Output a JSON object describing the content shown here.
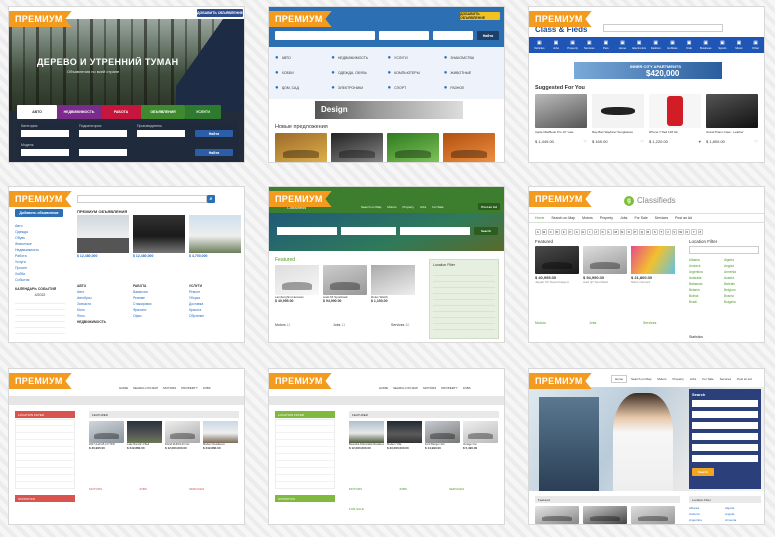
{
  "badge": "ПРЕМИУМ",
  "t1": {
    "hero_title": "ДЕРЕВО И УТРЕННИЙ ТУМАН",
    "hero_sub": "Объявления по всей стране",
    "tabs": [
      "АВТО",
      "НЕДВИЖИМОСТЬ",
      "РАБОТА",
      "ОБЪЯВЛЕНИЯ",
      "УСЛУГИ"
    ],
    "f_labels": [
      "Категория",
      "Подкатегория",
      "Производитель",
      "Модель"
    ],
    "find": "Найти",
    "top": "ДОБАВИТЬ ОБЪЯВЛЕНИЕ"
  },
  "t2": {
    "post": "ДОБАВИТЬ ОБЪЯВЛЕНИЕ",
    "search": "Найти",
    "cats": [
      "АВТО",
      "НЕДВИЖИМОСТЬ",
      "УСЛУГИ",
      "ЗНАКОМСТВА",
      "ХОББИ",
      "ОДЕЖДА, ОБУВЬ",
      "КОМПЬЮТЕРЫ",
      "ЖИВОТНЫЕ",
      "ДОМ, САД",
      "ЭЛЕКТРОНИКА",
      "СПОРТ",
      "РАЗНОЕ"
    ],
    "banner": "Design",
    "new": "Новые предложения"
  },
  "t3": {
    "logo": "Class & Fieds",
    "banner_top": "INNER CITY APARTMENTS",
    "banner_price": "$420,000",
    "suggested": "Suggested For You",
    "items": [
      {
        "name": "Apple MacBook Pro 13\" Late",
        "price": "$ 1,449.00"
      },
      {
        "name": "Ray-Ban Wayfarer Sunglasses",
        "price": "$ 169.00"
      },
      {
        "name": "iPhone 7 Red 128 Gb",
        "price": "$ 1,220.00"
      },
      {
        "name": "Grand Piano Case - Leather",
        "price": "$ 1,800.00"
      }
    ],
    "nav": [
      "Vehicles",
      "Jobs",
      "Property",
      "Services",
      "Pets",
      "Home",
      "Electronics",
      "Fashion",
      "Hobbies",
      "Kids",
      "Business",
      "Sports",
      "Music",
      "Other"
    ]
  },
  "t4": {
    "post": "Добавить объявление",
    "section": "ПРЕМИУМ ОБЪЯВЛЕНИЯ",
    "side": [
      "Авто",
      "Одежда",
      "Обувь",
      "Животные",
      "Недвижимость",
      "Работа",
      "Услуги",
      "Прочее",
      "Хобби",
      "События"
    ],
    "cal": "КАЛЕНДАРЬ СОБЫТИЙ",
    "month": "4/2022",
    "prices": [
      "$ 12,480,000",
      "$ 12,480,000",
      "$ 4,700,000"
    ],
    "cols": [
      {
        "h": "АВТО",
        "items": [
          "Авто",
          "Автобусы",
          "Запчасти",
          "Мото",
          "Яхты"
        ]
      },
      {
        "h": "РАБОТА",
        "items": [
          "Вакансии",
          "Резюме",
          "Стажировки",
          "Фриланс",
          "Офис"
        ]
      },
      {
        "h": "УСЛУГИ",
        "items": [
          "Ремонт",
          "Уборка",
          "Доставка",
          "Красота",
          "Обучение"
        ]
      }
    ],
    "realty": "НЕДВИЖИМОСТЬ"
  },
  "t5": {
    "logo": "Classifieds",
    "menu": [
      "Search on Map",
      "Motors",
      "Property",
      "Jobs",
      "For Sale",
      "Services"
    ],
    "post": "Post an Ad",
    "featured": "Featured",
    "filter": "Location Filter",
    "prices": [
      "$ 40,995.00",
      "$ 94,990.00",
      "$ 1,150.00"
    ],
    "cards": [
      "Lamborghini Huracan",
      "Audi A5 Sportback",
      "Rolex Watch"
    ],
    "cats": [
      {
        "h": "Motors",
        "n": "11"
      },
      {
        "h": "Jobs",
        "n": "11"
      },
      {
        "h": "Services",
        "n": "10"
      }
    ],
    "search": "Search"
  },
  "t6": {
    "logo": "Classifieds",
    "menu": [
      "Home",
      "Search on Map",
      "Motors",
      "Property",
      "Jobs",
      "For Sale",
      "Services",
      "Post an Ad"
    ],
    "letters": [
      "A",
      "B",
      "C",
      "D",
      "E",
      "F",
      "G",
      "H",
      "I",
      "J",
      "K",
      "L",
      "M",
      "N",
      "O",
      "P",
      "Q",
      "R",
      "S",
      "T",
      "U",
      "V",
      "W",
      "X",
      "Y",
      "Z"
    ],
    "featured": "Featured",
    "filter": "Location Filter",
    "countries": [
      "Albania",
      "Algeria",
      "Andorra",
      "Angola",
      "Argentina",
      "Armenia",
      "Australia",
      "Austria",
      "Bahamas",
      "Bahrain",
      "Belarus",
      "Belgium",
      "Bolivia",
      "Bosnia",
      "Brazil",
      "Bulgaria"
    ],
    "cards": [
      {
        "p": "$ 40,995.00",
        "n": "Jaguar XF Supercharged"
      },
      {
        "p": "$ 94,990.00",
        "n": "Audi Q7 Sportback"
      },
      {
        "p": "$ 21,800.00",
        "n": "Nikon Camera"
      }
    ],
    "cats": [
      "Motors",
      "Jobs",
      "Services"
    ],
    "stats": "Statistics"
  },
  "t7": {
    "logo": "CLASSIFIEDS",
    "menu": [
      "HOME",
      "SEARCH ON MAP",
      "MOTORS",
      "PROPERTY",
      "JOBS",
      "FOR SALE",
      "SERVICES",
      "POST AN AD"
    ],
    "left": "LOCATION FILTER",
    "feat": "FEATURED",
    "cards": [
      {
        "p": "$ 30,995.00",
        "n": "2017 Audi A5 2.0 TFSI"
      },
      {
        "p": "$ 242,880.00",
        "n": "Lake Bucolic 4 Bed"
      },
      {
        "p": "$ 12,000,000.00",
        "n": "DANA RUDOLFO GL"
      },
      {
        "p": "$ 242,880.00",
        "n": "Modern Residence"
      }
    ],
    "cats": [
      "MOTORS",
      "JOBS",
      "SERVICES"
    ],
    "stats": "STATISTICS"
  },
  "t8": {
    "logo": "CLASSIFIEDS",
    "menu": [
      "HOME",
      "SEARCH ON MAP",
      "MOTORS",
      "PROPERTY",
      "JOBS",
      "FOR SALE",
      "SERVICES",
      "POST AN AD"
    ],
    "left": "LOCATION FILTER",
    "feat": "FEATURED",
    "cards": [
      {
        "p": "$ 12,000,000.00",
        "n": "Beautiful Adirondack Residence"
      },
      {
        "p": "$ 33,000,000.00",
        "n": "Modern Villa"
      },
      {
        "p": "$ 14,990.00",
        "n": "Ford Ranger 4x4"
      },
      {
        "p": "$ 5,490.00",
        "n": "Vintage Car"
      }
    ],
    "cats": [
      "MOTORS",
      "JOBS",
      "SERVICES"
    ],
    "forsale": "FOR SALE",
    "stats": "STATISTICS"
  },
  "t9": {
    "menu": [
      "Home",
      "Search on Map",
      "Motors",
      "Property",
      "Jobs",
      "For Sale",
      "Services",
      "Post an Ad"
    ],
    "search_title": "Search",
    "featured": "Featured",
    "filter": "Location Filter",
    "countries": [
      "Albania",
      "Algeria",
      "Andorra",
      "Angola",
      "Argentina",
      "Armenia",
      "Australia"
    ],
    "go": "Search"
  }
}
